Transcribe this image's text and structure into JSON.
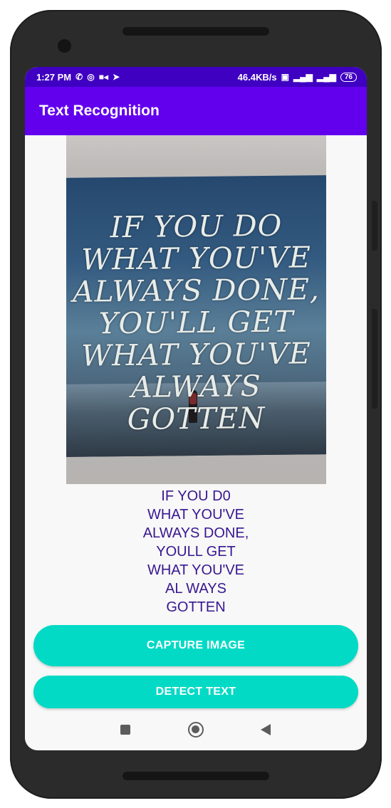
{
  "status_bar": {
    "time": "1:27 PM",
    "left_icons": [
      "viber-icon",
      "whatsapp-icon",
      "video-camera-icon",
      "telegram-icon"
    ],
    "network_speed": "46.4KB/s",
    "right_icons": [
      "volte-icon",
      "signal-4g-icon",
      "signal-icon"
    ],
    "battery": "76",
    "color": "#3f00c2"
  },
  "app_bar": {
    "title": "Text Recognition",
    "color": "#6200ee"
  },
  "image": {
    "poster_lines": [
      "IF YOU DO",
      "WHAT YOU'VE",
      "ALWAYS DONE,",
      "YOU'LL GET",
      "WHAT YOU'VE",
      "ALWAYS",
      "GOTTEN"
    ]
  },
  "result": {
    "lines": [
      "IF YOU D0",
      "WHAT YOU'VE",
      "ALWAYS DONE,",
      "YOULL GET",
      "WHAT YOU'VE",
      "AL WAYS",
      "GOTTEN"
    ],
    "color": "#3a1691"
  },
  "buttons": {
    "capture_label": "CAPTURE IMAGE",
    "detect_label": "DETECT TEXT",
    "color": "#03dac5"
  },
  "nav_bar": {
    "icons": [
      "recents-square-icon",
      "home-circle-icon",
      "back-triangle-icon"
    ]
  }
}
